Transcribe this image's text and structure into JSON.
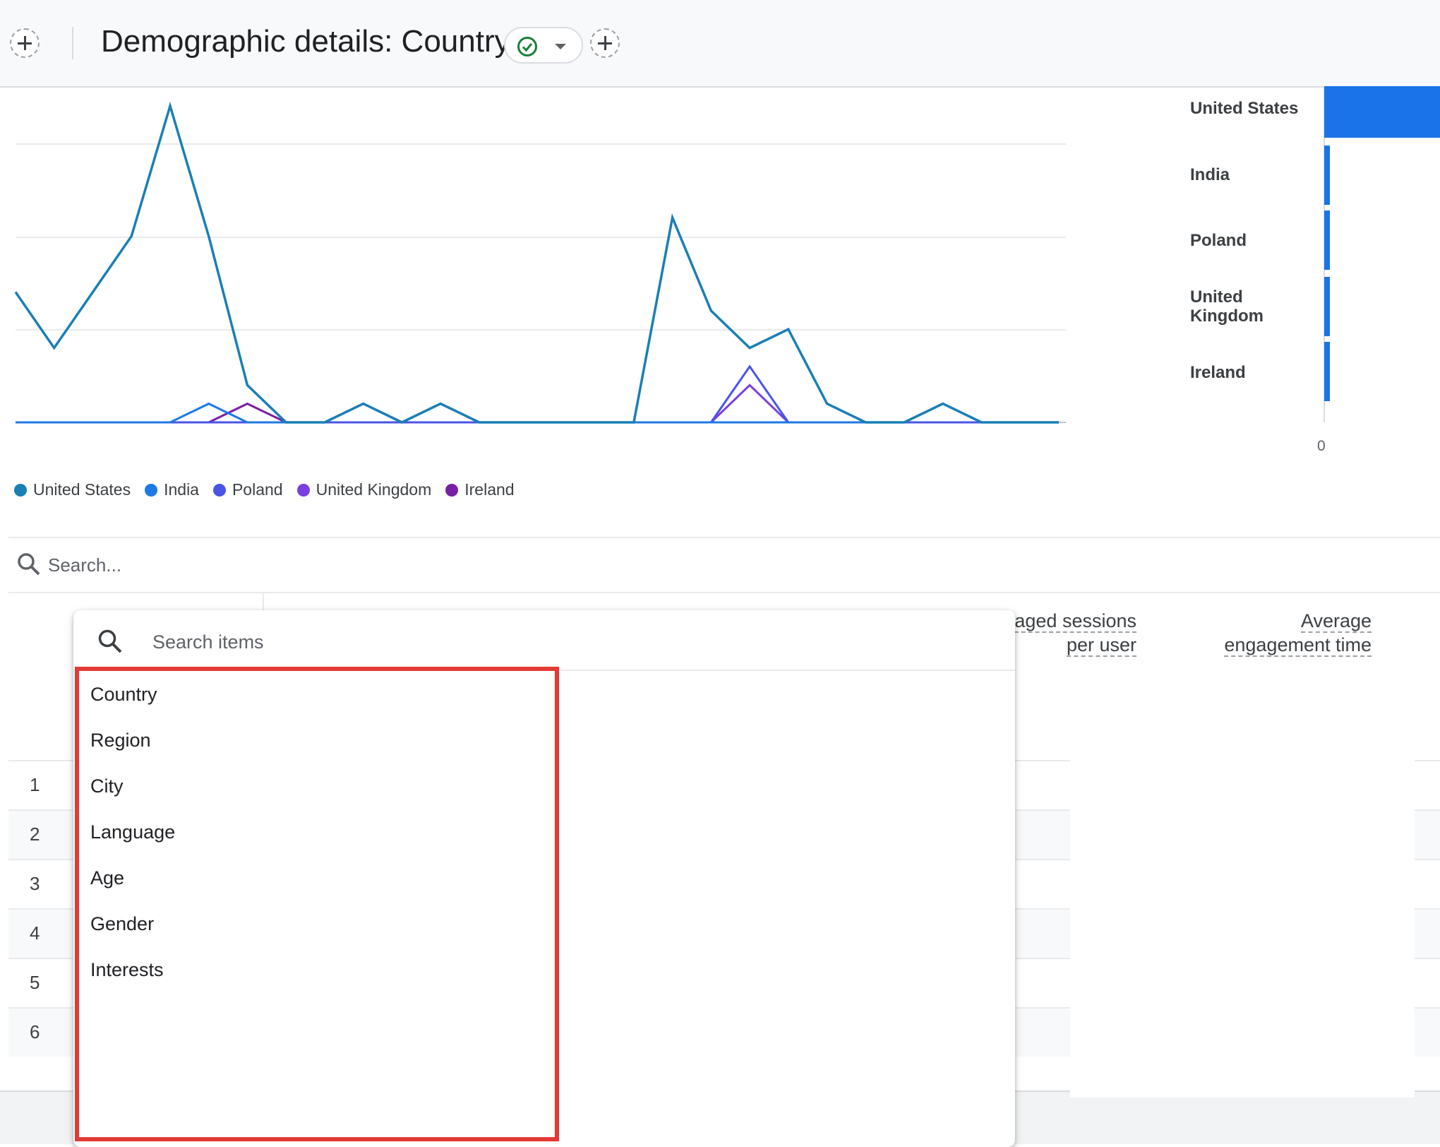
{
  "header": {
    "title": "Demographic details: Country",
    "add_left_icon": "add-circle-dashed-icon",
    "status_icon": "check-circle-icon",
    "dropdown_icon": "caret-down-icon",
    "add_right_icon": "add-circle-dashed-icon"
  },
  "colors": {
    "united_states": "#1a7fb5",
    "india": "#1e79e6",
    "poland": "#4a55e8",
    "united_kingdom": "#7a3fe0",
    "ireland": "#7a1fa2",
    "bar": "#1a73e8",
    "highlight": "#e53935"
  },
  "chart_data": [
    {
      "type": "line",
      "x": [
        0,
        1,
        2,
        3,
        4,
        5,
        6,
        7,
        8,
        9,
        10,
        11,
        12,
        13,
        14,
        15,
        16,
        17,
        18,
        19,
        20,
        21,
        22,
        23,
        24,
        25,
        26,
        27
      ],
      "series": [
        {
          "name": "United States",
          "values": [
            7,
            4,
            7,
            10,
            17,
            10,
            2,
            0,
            0,
            1,
            0,
            1,
            0,
            0,
            0,
            0,
            0,
            11,
            6,
            4,
            5,
            1,
            0,
            0,
            1,
            0,
            0,
            0
          ]
        },
        {
          "name": "India",
          "values": [
            0,
            0,
            0,
            0,
            0,
            1,
            0,
            0,
            0,
            1,
            0,
            1,
            0,
            0,
            0,
            0,
            0,
            0,
            0,
            0,
            0,
            0,
            0,
            0,
            1,
            0,
            0,
            0
          ]
        },
        {
          "name": "Poland",
          "values": [
            0,
            0,
            0,
            0,
            0,
            0,
            0,
            0,
            0,
            0,
            0,
            0,
            0,
            0,
            0,
            0,
            0,
            0,
            0,
            3,
            0,
            0,
            0,
            0,
            0,
            0,
            0,
            0
          ]
        },
        {
          "name": "United Kingdom",
          "values": [
            0,
            0,
            0,
            0,
            0,
            0,
            0,
            0,
            0,
            0,
            0,
            0,
            0,
            0,
            0,
            0,
            0,
            0,
            0,
            2,
            0,
            0,
            0,
            0,
            0,
            0,
            0,
            0
          ]
        },
        {
          "name": "Ireland",
          "values": [
            0,
            0,
            0,
            0,
            0,
            0,
            1,
            0,
            0,
            0,
            0,
            0,
            0,
            0,
            0,
            0,
            0,
            0,
            0,
            0,
            0,
            0,
            0,
            0,
            0,
            0,
            0,
            0
          ]
        }
      ],
      "ylim": [
        0,
        17
      ],
      "grid": true,
      "legend": "bottom"
    },
    {
      "type": "bar",
      "orientation": "horizontal",
      "categories": [
        "United States",
        "India",
        "Poland",
        "United Kingdom",
        "Ireland"
      ],
      "values": [
        100,
        3.5,
        3.5,
        2.2,
        1.2
      ],
      "xtick_labels": [
        "0"
      ]
    }
  ],
  "table": {
    "search_placeholder": "Search...",
    "columns": [
      {
        "line1": "aged sessions",
        "line2": "per user"
      },
      {
        "line1": "Average",
        "line2": "engagement time"
      }
    ],
    "rows": [
      "1",
      "2",
      "3",
      "4",
      "5",
      "6"
    ]
  },
  "dropdown": {
    "search_placeholder": "Search items",
    "items": [
      "Country",
      "Region",
      "City",
      "Language",
      "Age",
      "Gender",
      "Interests"
    ]
  }
}
